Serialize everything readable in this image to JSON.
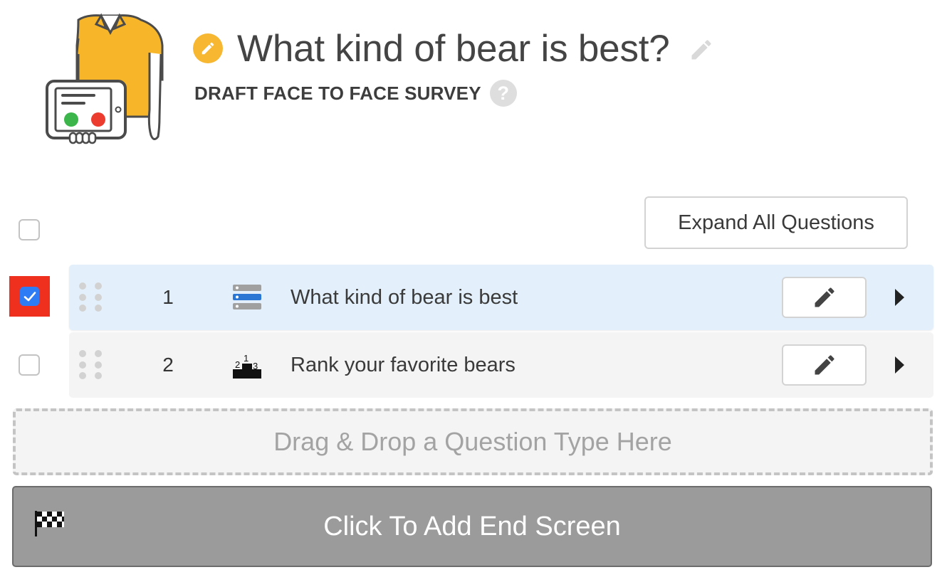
{
  "header": {
    "title": "What kind of bear is best?",
    "subtitle": "DRAFT FACE TO FACE SURVEY",
    "help_glyph": "?",
    "accent_color": "#f7b731"
  },
  "toolbar": {
    "expand_all_label": "Expand All Questions",
    "select_all_checked": false
  },
  "questions": [
    {
      "number": "1",
      "text": "What kind of bear is best",
      "type_icon": "multiple-choice-icon",
      "checked": true
    },
    {
      "number": "2",
      "text": "Rank your favorite bears",
      "type_icon": "ranking-podium-icon",
      "rank_digits": [
        "2",
        "1",
        "3"
      ],
      "checked": false
    }
  ],
  "dropzone": {
    "label": "Drag & Drop a Question Type Here"
  },
  "end_screen": {
    "label": "Click To Add End Screen",
    "icon": "checkered-flag-icon"
  },
  "colors": {
    "selected_row_bg": "#e3f0fb",
    "checkbox_highlight": "#f0301e",
    "checkbox_checked": "#2e7bf6",
    "end_screen_bg": "#9b9b9b"
  }
}
